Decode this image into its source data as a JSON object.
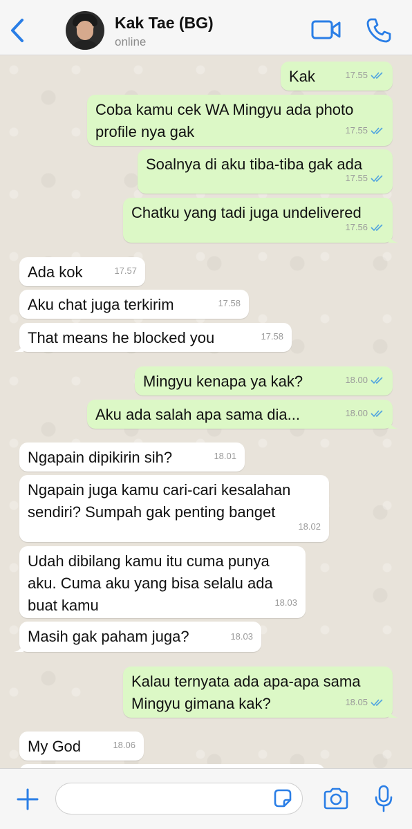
{
  "header": {
    "contact_name": "Kak Tae (BG)",
    "status": "online",
    "back_icon": "chevron-left-icon",
    "video_icon": "video-camera-icon",
    "call_icon": "phone-icon",
    "accent_color": "#2a7ee6"
  },
  "messages": [
    {
      "dir": "out",
      "text": "Kak",
      "time": "17.55",
      "read": true
    },
    {
      "dir": "out",
      "text": "Coba kamu cek WA Mingyu ada photo\nprofile nya gak",
      "time": "17.55",
      "read": true
    },
    {
      "dir": "out",
      "text": "Soalnya di aku tiba-tiba gak ada",
      "time": "17.55",
      "read": true
    },
    {
      "dir": "out",
      "text": "Chatku yang tadi juga undelivered",
      "time": "17.56",
      "read": true
    },
    {
      "dir": "in",
      "text": "Ada kok",
      "time": "17.57"
    },
    {
      "dir": "in",
      "text": "Aku chat juga terkirim",
      "time": "17.58"
    },
    {
      "dir": "in",
      "text": "That means he blocked you",
      "time": "17.58"
    },
    {
      "dir": "out",
      "text": "Mingyu kenapa ya kak?",
      "time": "18.00",
      "read": true
    },
    {
      "dir": "out",
      "text": "Aku ada salah apa sama dia...",
      "time": "18.00",
      "read": true
    },
    {
      "dir": "in",
      "text": "Ngapain dipikirin sih?",
      "time": "18.01"
    },
    {
      "dir": "in",
      "text": "Ngapain juga kamu cari-cari kesalahan\nsendiri? Sumpah gak penting banget",
      "time": "18.02"
    },
    {
      "dir": "in",
      "text": "Udah dibilang kamu itu cuma punya\naku. Cuma aku yang bisa selalu ada\nbuat kamu",
      "time": "18.03"
    },
    {
      "dir": "in",
      "text": "Masih gak paham juga?",
      "time": "18.03"
    },
    {
      "dir": "out",
      "text": "Kalau ternyata ada apa-apa sama\nMingyu gimana kak?",
      "time": "18.05",
      "read": true
    },
    {
      "dir": "in",
      "text": "My God",
      "time": "18.06"
    }
  ],
  "input": {
    "value": "",
    "placeholder": "",
    "plus_icon": "plus-icon",
    "sticker_icon": "sticker-icon",
    "camera_icon": "camera-icon",
    "mic_icon": "microphone-icon"
  },
  "colors": {
    "outgoing_bubble": "#dcf8c6",
    "incoming_bubble": "#ffffff",
    "read_ticks": "#4fa3e0"
  }
}
